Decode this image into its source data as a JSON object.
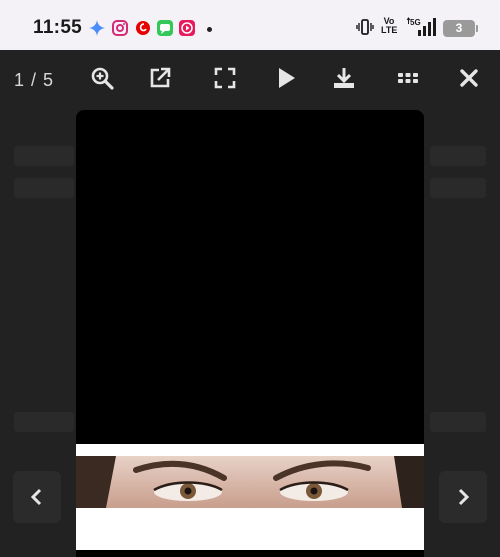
{
  "status_bar": {
    "time": "11:55",
    "notification_icons": [
      "gemini-icon",
      "instagram-icon",
      "vodafone-icon",
      "messages-icon",
      "video-player-icon"
    ],
    "volte_top": "Vo",
    "volte_bottom": "LTE",
    "network": "5G",
    "battery": "3"
  },
  "toolbar": {
    "counter": "1 / 5",
    "buttons": [
      "zoom-in",
      "open-external",
      "fullscreen",
      "play-slideshow",
      "download",
      "thumbnails",
      "close"
    ]
  },
  "colors": {
    "toolbar_icon": "#e6e6e6",
    "background": "#1e1e1e",
    "status_bar": "#f4f2f7"
  }
}
